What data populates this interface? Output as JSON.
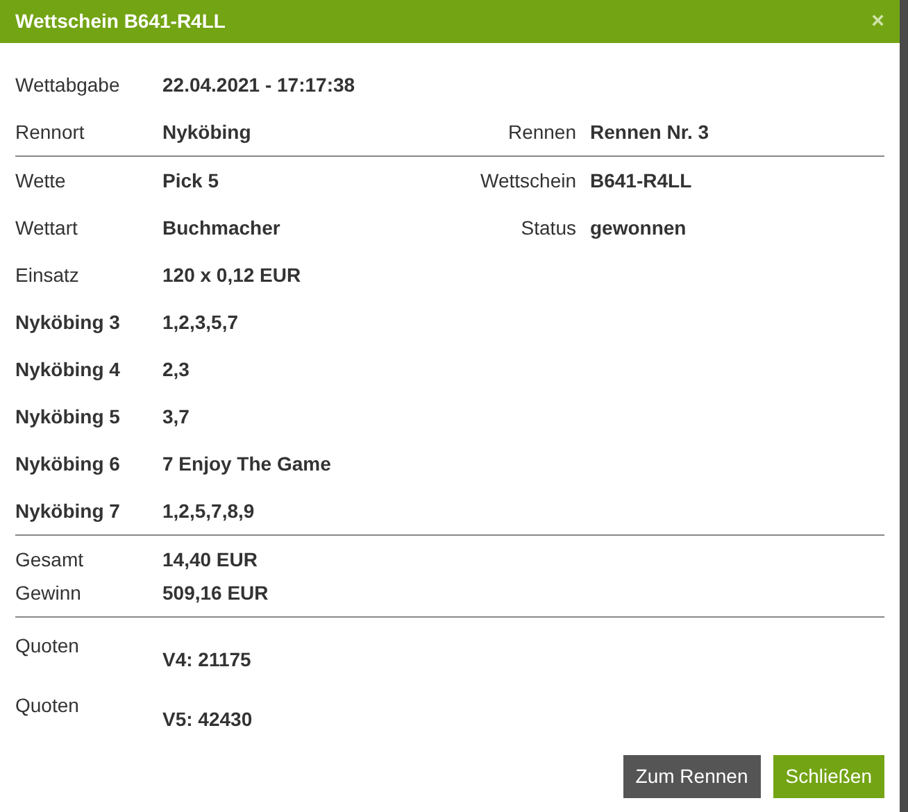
{
  "dialog": {
    "title": "Wettschein B641-R4LL",
    "close": "×"
  },
  "sections": [
    {
      "kind": "normal",
      "rows": [
        {
          "kind": "field",
          "label": "Wettabgabe",
          "value": "22.04.2021 - 17:17:38"
        },
        {
          "kind": "field",
          "label": "Rennort",
          "value": "Nyköbing",
          "extra_label": "Rennen",
          "extra_value": "Rennen Nr. 3"
        }
      ]
    },
    {
      "kind": "normal",
      "rows": [
        {
          "kind": "field",
          "label": "Wette",
          "value": "Pick 5",
          "extra_label": "Wettschein",
          "extra_value": "B641-R4LL"
        },
        {
          "kind": "field",
          "label": "Wettart",
          "value": "Buchmacher",
          "extra_label": "Status",
          "extra_value": "gewonnen"
        },
        {
          "kind": "field",
          "label": "Einsatz",
          "value": "120 x 0,12 EUR"
        },
        {
          "kind": "leg",
          "label": "Nyköbing 3",
          "value": "1,2,3,5,7"
        },
        {
          "kind": "leg",
          "label": "Nyköbing 4",
          "value": "2,3"
        },
        {
          "kind": "leg",
          "label": "Nyköbing 5",
          "value": "3,7"
        },
        {
          "kind": "leg",
          "label": "Nyköbing 6",
          "value": "7 Enjoy The Game"
        },
        {
          "kind": "leg",
          "label": "Nyköbing 7",
          "value": "1,2,5,7,8,9"
        }
      ]
    },
    {
      "kind": "compact",
      "rows": [
        {
          "kind": "field",
          "label": "Gesamt",
          "value": "14,40 EUR"
        },
        {
          "kind": "field",
          "label": "Gewinn",
          "value": "509,16 EUR"
        }
      ]
    },
    {
      "kind": "quote",
      "rows": [
        {
          "kind": "field",
          "label": "Quoten",
          "value": "V4: 21175"
        },
        {
          "kind": "field",
          "label": "Quoten",
          "value": "V5: 42430"
        }
      ]
    }
  ],
  "buttons": [
    {
      "label": "Zum Rennen",
      "kind": "secondary"
    },
    {
      "label": "Schließen",
      "kind": "primary"
    }
  ]
}
